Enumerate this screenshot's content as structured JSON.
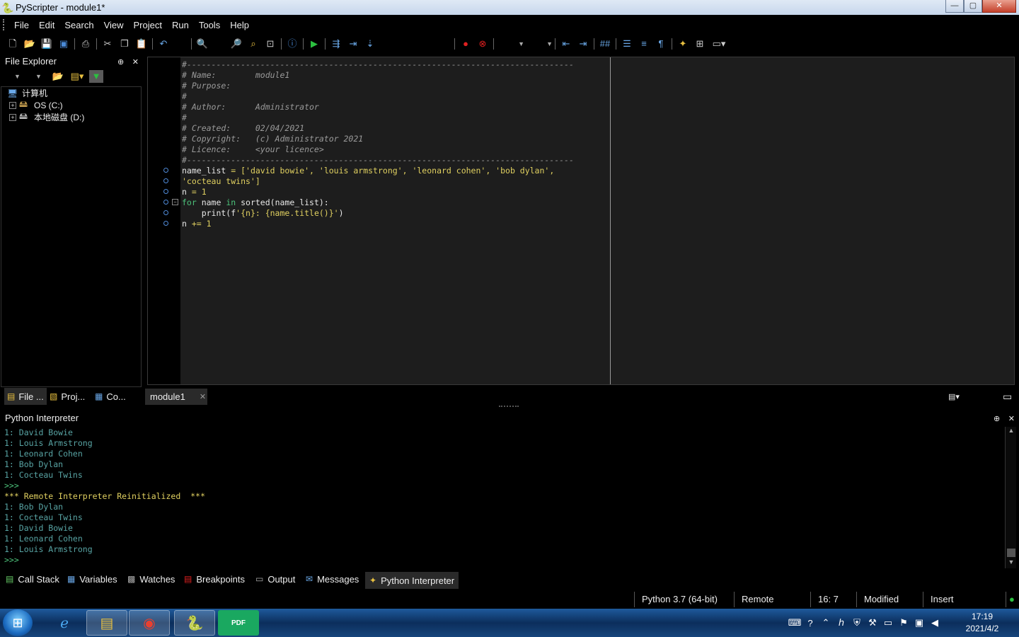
{
  "window": {
    "title": "PyScripter - module1*",
    "min": "—",
    "max": "▢",
    "close": "✕"
  },
  "menu": [
    "File",
    "Edit",
    "Search",
    "View",
    "Project",
    "Run",
    "Tools",
    "Help"
  ],
  "file_explorer": {
    "title": "File Explorer",
    "pin": "⊕",
    "close": "✕",
    "nodes": [
      {
        "label": "计算机",
        "icon": "computer-icon",
        "level": 0
      },
      {
        "label": "OS (C:)",
        "icon": "drive-icon",
        "level": 1
      },
      {
        "label": "本地磁盘 (D:)",
        "icon": "drive-icon",
        "level": 1
      }
    ]
  },
  "editor": {
    "header_lines": [
      "#-------------------------------------------------------------------------------",
      "# Name:        module1",
      "# Purpose:",
      "#",
      "# Author:      Administrator",
      "#",
      "# Created:     02/04/2021",
      "# Copyright:   (c) Administrator 2021",
      "# Licence:     <your licence>",
      "#-------------------------------------------------------------------------------"
    ],
    "code": {
      "l1a": "name_list",
      "l1b": " = [",
      "l1c": "'david bowie'",
      "l1d": ", ",
      "l1e": "'louis armstrong'",
      "l1f": ", ",
      "l1g": "'leonard cohen'",
      "l1h": ", ",
      "l1i": "'bob dylan'",
      "l1j": ",",
      "l2a": "'cocteau twins'",
      "l2b": "]",
      "l3a": "n",
      "l3b": " = ",
      "l3c": "1",
      "l4a": "for",
      "l4b": " name ",
      "l4c": "in",
      "l4d": " sorted(name_list):",
      "l5a": "    print(f",
      "l5b": "'{n}: {name.title()}'",
      "l5c": ")",
      "l6a": "n",
      "l6b": " += ",
      "l6c": "1"
    }
  },
  "left_tabs": [
    {
      "label": "File ...",
      "icon": "file-explorer-icon"
    },
    {
      "label": "Proj...",
      "icon": "project-icon"
    },
    {
      "label": "Co...",
      "icon": "code-explorer-icon"
    }
  ],
  "doc_tab": {
    "label": "module1",
    "close": "✕"
  },
  "interpreter": {
    "title": "Python Interpreter",
    "pin": "⊕",
    "close": "✕",
    "lines": [
      {
        "t": "1: David Bowie",
        "k": "out"
      },
      {
        "t": "1: Louis Armstrong",
        "k": "out"
      },
      {
        "t": "1: Leonard Cohen",
        "k": "out"
      },
      {
        "t": "1: Bob Dylan",
        "k": "out"
      },
      {
        "t": "1: Cocteau Twins",
        "k": "out"
      },
      {
        "t": ">>>",
        "k": "prompt"
      },
      {
        "t": "*** Remote Interpreter Reinitialized  ***",
        "k": "sys"
      },
      {
        "t": "1: Bob Dylan",
        "k": "out"
      },
      {
        "t": "1: Cocteau Twins",
        "k": "out"
      },
      {
        "t": "1: David Bowie",
        "k": "out"
      },
      {
        "t": "1: Leonard Cohen",
        "k": "out"
      },
      {
        "t": "1: Louis Armstrong",
        "k": "out"
      },
      {
        "t": ">>>",
        "k": "prompt"
      }
    ]
  },
  "bottom_tabs": [
    {
      "label": "Call Stack",
      "icon": "call-stack-icon"
    },
    {
      "label": "Variables",
      "icon": "variables-icon"
    },
    {
      "label": "Watches",
      "icon": "watches-icon"
    },
    {
      "label": "Breakpoints",
      "icon": "breakpoints-icon"
    },
    {
      "label": "Output",
      "icon": "output-icon"
    },
    {
      "label": "Messages",
      "icon": "messages-icon"
    },
    {
      "label": "Python Interpreter",
      "icon": "python-icon",
      "active": true
    }
  ],
  "status": {
    "python": "Python 3.7 (64-bit)",
    "engine": "Remote",
    "position": "16:  7",
    "modified": "Modified",
    "mode": "Insert"
  },
  "taskbar": {
    "time": "17:19",
    "date": "2021/4/2",
    "apps": [
      "internet-explorer-icon",
      "file-explorer-icon",
      "chrome-icon",
      "pyscripter-icon",
      "pdf-icon"
    ],
    "pdf_label": "PDF"
  },
  "colors": {
    "comment": "#9a9a9a",
    "string": "#e0d060",
    "keyword": "#4cc27a",
    "output": "#58a4a4"
  }
}
